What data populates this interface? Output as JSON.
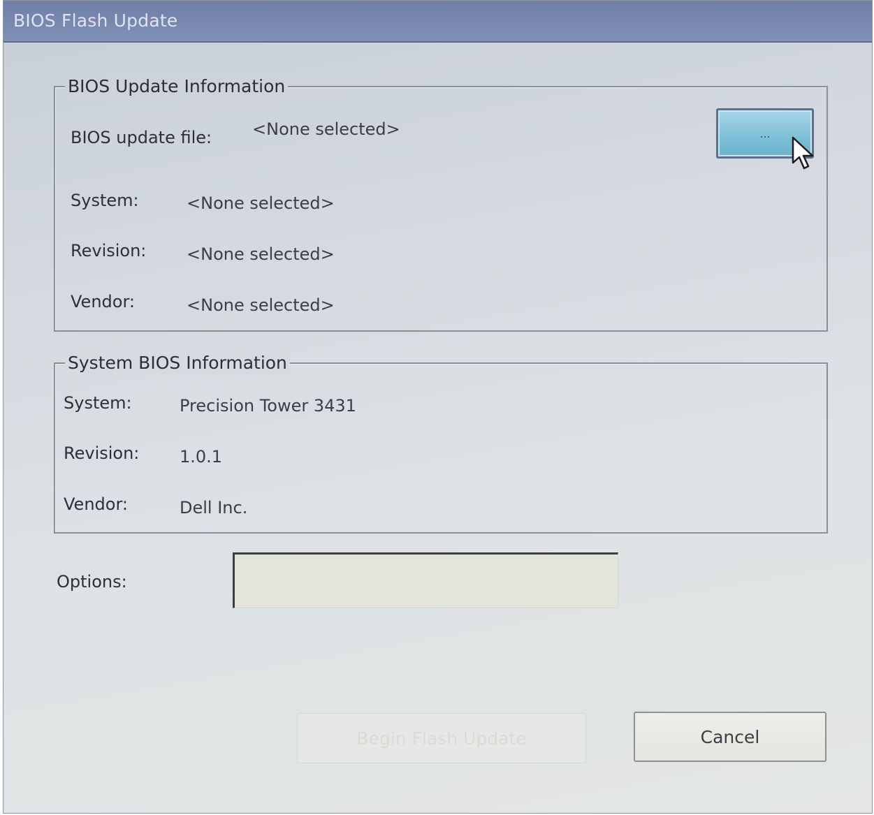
{
  "window": {
    "title": "BIOS Flash Update"
  },
  "update_info": {
    "title": "BIOS Update Information",
    "file_label": "BIOS update file:",
    "file_value": "<None selected>",
    "browse_label": "...",
    "system_label": "System:",
    "system_value": "<None selected>",
    "revision_label": "Revision:",
    "revision_value": "<None selected>",
    "vendor_label": "Vendor:",
    "vendor_value": "<None selected>"
  },
  "system_info": {
    "title": "System BIOS Information",
    "system_label": "System:",
    "system_value": "Precision Tower 3431",
    "revision_label": "Revision:",
    "revision_value": "1.0.1",
    "vendor_label": "Vendor:",
    "vendor_value": "Dell Inc."
  },
  "options": {
    "label": "Options:",
    "value": ""
  },
  "buttons": {
    "begin_flash": "Begin Flash Update",
    "cancel": "Cancel"
  },
  "colors": {
    "title_bar": "#7888b0",
    "browse_button": "#7cc0d8"
  },
  "icons": {
    "cursor": "arrow-cursor-icon"
  }
}
